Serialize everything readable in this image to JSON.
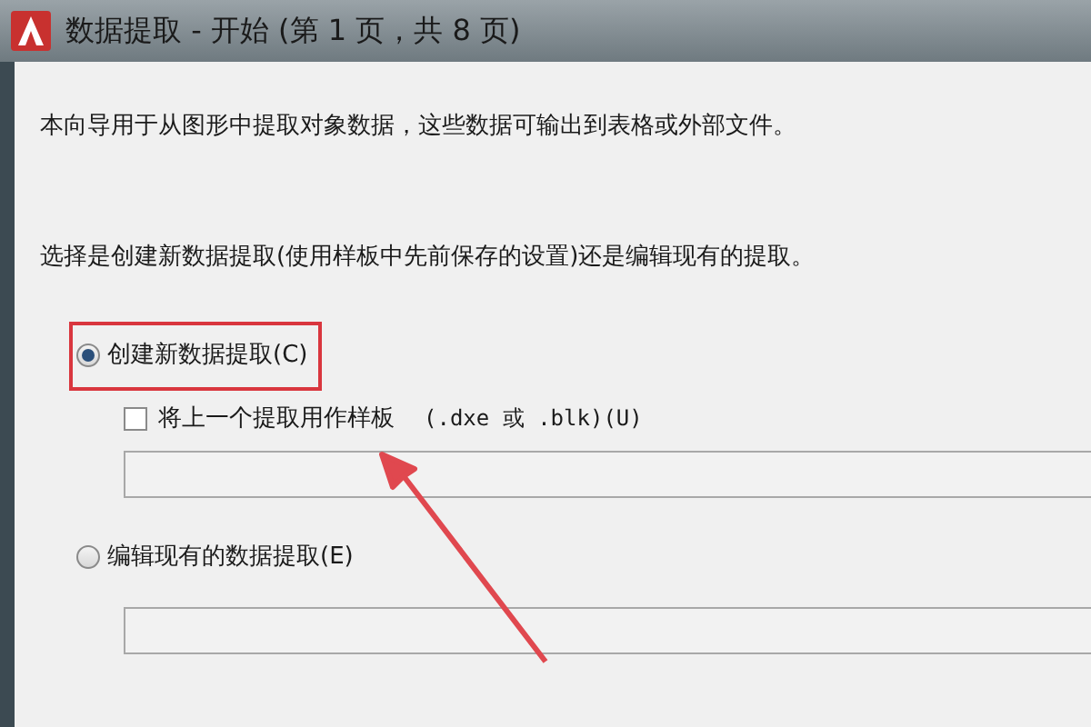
{
  "window": {
    "title": "数据提取 - 开始 (第 1 页，共 8 页)"
  },
  "intro": "本向导用于从图形中提取对象数据，这些数据可输出到表格或外部文件。",
  "prompt": "选择是创建新数据提取(使用样板中先前保存的设置)还是编辑现有的提取。",
  "options": [
    {
      "label": "创建新数据提取(C)",
      "selected": true,
      "highlighted": true,
      "checkbox": {
        "label": "将上一个提取用作样板",
        "suffix": "(.dxe 或 .blk)(U)",
        "checked": false
      }
    },
    {
      "label": "编辑现有的数据提取(E)",
      "selected": false,
      "highlighted": false
    }
  ]
}
